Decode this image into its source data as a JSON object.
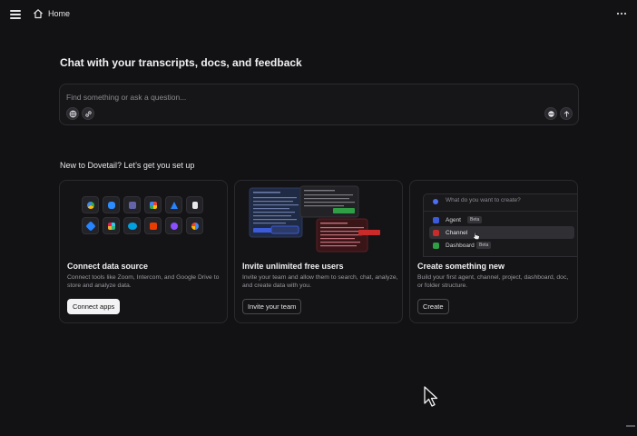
{
  "header": {
    "home_label": "Home",
    "icons": [
      "menu-icon",
      "home-icon",
      "more-icon"
    ]
  },
  "main": {
    "title": "Chat with your transcripts, docs, and feedback",
    "search": {
      "placeholder": "Find something or ask a question...",
      "value": "",
      "icons": [
        "globe-icon",
        "link-icon",
        "web-search-icon",
        "send-arrow-icon"
      ]
    }
  },
  "setup": {
    "title": "New to Dovetail? Let’s get you set up",
    "cards": [
      {
        "title": "Connect data source",
        "description": "Connect tools like Zoom, Intercom, and Google Drive to store and analyze data.",
        "button": "Connect apps"
      },
      {
        "title": "Invite unlimited free users",
        "description": "Invite your team and allow them to search, chat, analyze, and create data with you.",
        "button": "Invite your team"
      },
      {
        "title": "Create something new",
        "description": "Build your first agent, channel, project, dashboard, doc, or folder structure.",
        "button": "Create",
        "illustration": {
          "prompt": "What do you want to create?",
          "options": [
            "Agent",
            "Channel",
            "Dashboard"
          ],
          "badges": [
            "Beta",
            "Beta"
          ]
        }
      }
    ]
  },
  "colors": {
    "background": "#121214",
    "card_background": "#141416",
    "border": "#2a2a2e",
    "accent_blue": "#3b5bdb",
    "accent_red": "#c92a2a",
    "accent_green": "#2f9e44"
  }
}
